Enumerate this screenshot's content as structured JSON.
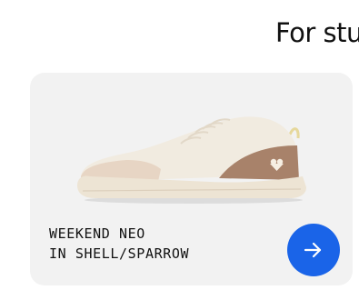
{
  "page": {
    "heading": "For stu"
  },
  "product_card": {
    "name_line1": "WEEKEND NEO",
    "name_line2": "IN SHELL/SPARROW",
    "image_alt": "sneaker-image",
    "action_icon": "arrow-right-icon",
    "colors": {
      "card_background": "#f2f2f2",
      "button": "#1a64e8",
      "shoe_upper": "#f1ebe0",
      "shoe_accent": "#a8826a",
      "shoe_sole": "#ede4d4"
    }
  }
}
